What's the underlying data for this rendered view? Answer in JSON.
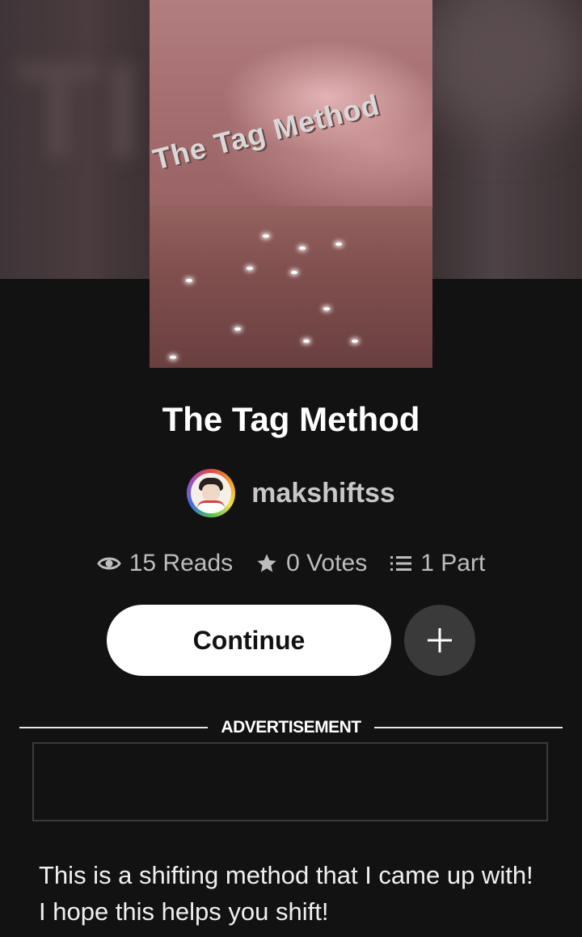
{
  "story": {
    "cover_text": "The Tag Method",
    "title": "The Tag Method",
    "author": "makshiftss",
    "stats": {
      "reads": "15 Reads",
      "votes": "0 Votes",
      "parts": "1 Part"
    },
    "continue_label": "Continue",
    "advertisement_label": "ADVERTISEMENT",
    "description_line1": "This is a shifting method that I came up with!",
    "description_line2": "I hope this helps you shift!"
  },
  "icons": {
    "reads": "eye-icon",
    "votes": "star-icon",
    "parts": "list-icon",
    "add": "plus-icon"
  },
  "colors": {
    "background": "#121212",
    "button_primary": "#ffffff",
    "button_secondary": "#3a3a3a",
    "muted_text": "#bdbdbd"
  }
}
